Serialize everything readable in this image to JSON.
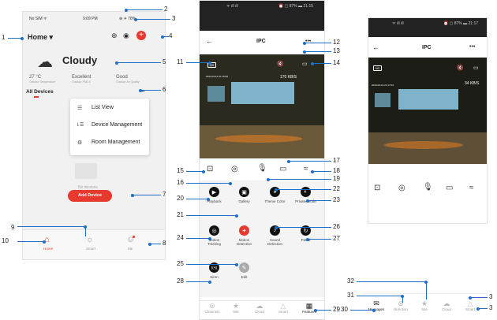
{
  "left": {
    "status": {
      "carrier": "No SIM ᯤ",
      "time": "9:09 PM",
      "battery": "⊕ ✈ 78%"
    },
    "home_label": "Home ▾",
    "weather": {
      "condition": "Cloudy",
      "temp": "27 °C",
      "temp_sub": "Outdoor Temperature",
      "pm": "Excellent",
      "pm_sub": "Outdoor PM2.5",
      "air": "Good",
      "air_sub": "Outdoor Air Quality"
    },
    "all_devices": "All Devices",
    "menu": [
      {
        "icon": "☰",
        "label": "List View"
      },
      {
        "icon": "⇂☰",
        "label": "Device Management"
      },
      {
        "icon": "⚙",
        "label": "Room Management"
      }
    ],
    "no_devices": "No devices",
    "add_device": "Add Device",
    "tabs": [
      "Home",
      "Smart",
      "Me"
    ]
  },
  "middle": {
    "status": "ᯤ ıll ıll",
    "status_right": "⏰ ▢ 87% ▬ 21:15",
    "title": "IPC",
    "more": "•••",
    "hd": "HD",
    "speed": "170 KB/S",
    "timestamp": "2024-03-12 21:15:08",
    "features": [
      [
        {
          "label": "Playback",
          "icon": "▶"
        },
        {
          "label": "Gallery",
          "icon": "▣"
        },
        {
          "label": "Theme Color",
          "icon": "◕"
        },
        {
          "label": "Private Mode",
          "icon": "◐"
        }
      ],
      [
        {
          "label": "Motion Tracking",
          "icon": "◎"
        },
        {
          "label": "Motion Detection",
          "icon": "✦"
        },
        {
          "label": "Sound Detection",
          "icon": "♪"
        },
        {
          "label": "Patrol",
          "icon": "↻"
        }
      ],
      [
        {
          "label": "Siren",
          "icon": "((•))"
        },
        {
          "label": "Edit",
          "icon": "✎"
        }
      ]
    ],
    "tabs": [
      "Channels",
      "Site",
      "Cloud",
      "Smart",
      "Features"
    ]
  },
  "right": {
    "status": "ᯤ ıll ıll",
    "status_right": "⏰ ▢ 87% ▬ 21:17",
    "title": "IPC",
    "more": "•••",
    "hd": "HD",
    "speed": "34 KB/S",
    "timestamp": "2024-03-12 21:17:02",
    "tabs": [
      "Messages",
      "Direction",
      "Site",
      "Cloud",
      "Smart"
    ]
  },
  "callouts": [
    "1",
    "2",
    "3",
    "4",
    "5",
    "6",
    "7",
    "8",
    "9",
    "10",
    "11",
    "12",
    "13",
    "14",
    "15",
    "16",
    "17",
    "18",
    "19",
    "20",
    "21",
    "22",
    "23",
    "24",
    "25",
    "26",
    "27",
    "28",
    "29",
    "30",
    "31",
    "32",
    "3",
    "3"
  ],
  "colors": {
    "accent": "#e8392f",
    "callout": "#1e6fc6"
  }
}
